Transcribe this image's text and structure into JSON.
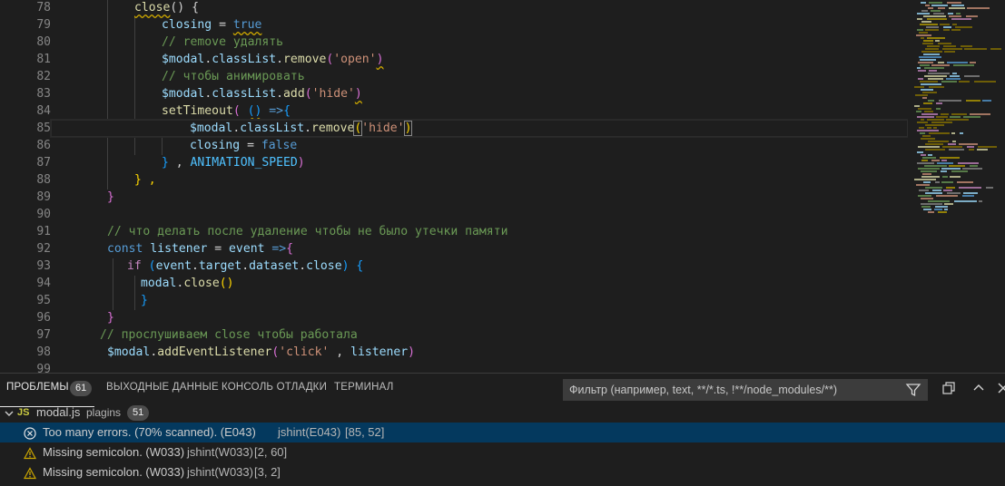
{
  "editor": {
    "lines": [
      {
        "n": "78"
      },
      {
        "n": "79"
      },
      {
        "n": "80"
      },
      {
        "n": "81"
      },
      {
        "n": "82"
      },
      {
        "n": "83"
      },
      {
        "n": "84"
      },
      {
        "n": "85"
      },
      {
        "n": "86"
      },
      {
        "n": "87"
      },
      {
        "n": "88"
      },
      {
        "n": "89"
      },
      {
        "n": "90"
      },
      {
        "n": "91"
      },
      {
        "n": "92"
      },
      {
        "n": "93"
      },
      {
        "n": "94"
      },
      {
        "n": "95"
      },
      {
        "n": "96"
      },
      {
        "n": "97"
      },
      {
        "n": "98"
      },
      {
        "n": "99"
      }
    ],
    "code": {
      "l78": {
        "fn": "close",
        "rest": "() {"
      },
      "l79": {
        "var": "closing",
        "eq": " = ",
        "val": "true"
      },
      "l80": {
        "comment": "// remove удалять"
      },
      "l81": {
        "obj": "$modal",
        "dot": ".",
        "prop": "classList",
        "dot2": ".",
        "method": "remove",
        "open": "(",
        "str": "'open'",
        "close": ")"
      },
      "l82": {
        "comment": "// чтобы анимировать"
      },
      "l83": {
        "obj": "$modal",
        "dot": ".",
        "prop": "classList",
        "dot2": ".",
        "method": "add",
        "open": "(",
        "str": "'hide'",
        "close": ")"
      },
      "l84": {
        "fn": "setTimeout",
        "open": "(",
        "sp": " ",
        "args": "()",
        "arrow": " =>",
        "brace": "{"
      },
      "l85": {
        "obj": "$modal",
        "dot": ".",
        "prop": "classList",
        "dot2": ".",
        "method": "remove",
        "open": "(",
        "str": "'hide'",
        "close": ")"
      },
      "l86": {
        "var": "closing",
        "eq": " = ",
        "val": "false"
      },
      "l87": {
        "brace": "}",
        "sep": " , ",
        "const": "ANIMATION_SPEED",
        "close": ")"
      },
      "l88": {
        "text": "} ,"
      },
      "l89": {
        "brace": "}"
      },
      "l91": {
        "comment": "// что делать после удаление чтобы не было утечки памяти"
      },
      "l92": {
        "kw": "const",
        "sp": " ",
        "var": "listener",
        "eq": " = ",
        "param": "event",
        "arrow": " =>",
        "brace": "{"
      },
      "l93": {
        "kw": "if",
        "sp": " ",
        "open": "(",
        "e1": "event",
        "d1": ".",
        "e2": "target",
        "d2": ".",
        "e3": "dataset",
        "d3": ".",
        "e4": "close",
        "close": ")",
        "brace": " {"
      },
      "l94": {
        "obj": "modal",
        "dot": ".",
        "method": "close",
        "paren": "()"
      },
      "l95": {
        "brace": "}"
      },
      "l96": {
        "brace": "}"
      },
      "l97": {
        "comment": "// прослушиваем close чтобы работала"
      },
      "l98": {
        "obj": "$modal",
        "dot": ".",
        "method": "addEventListener",
        "open": "(",
        "str": "'click'",
        "sep": " , ",
        "var": "listener",
        "close": ")"
      }
    }
  },
  "panel": {
    "tabs": [
      {
        "label": "ПРОБЛЕМЫ",
        "badge": "61"
      },
      {
        "label": "ВЫХОДНЫЕ ДАННЫЕ"
      },
      {
        "label": "КОНСОЛЬ ОТЛАДКИ"
      },
      {
        "label": "ТЕРМИНАЛ"
      }
    ],
    "filter_placeholder": "Фильтр (например, text, **/*.ts, !**/node_modules/**)",
    "file": {
      "icon_label": "JS",
      "name": "modal.js",
      "folder": "plagins",
      "count": "51"
    },
    "problems": [
      {
        "severity": "error",
        "message": "Too many errors. (70% scanned). (E043)",
        "source": "jshint(E043)",
        "pos": "[85, 52]"
      },
      {
        "severity": "warning",
        "message": "Missing semicolon. (W033)",
        "source": "jshint(W033)",
        "pos": "[2, 60]"
      },
      {
        "severity": "warning",
        "message": "Missing semicolon. (W033)",
        "source": "jshint(W033)",
        "pos": "[3, 2]"
      }
    ]
  },
  "colors": {
    "accent": "#04395e",
    "error": "#f48771",
    "warning": "#cca700",
    "js_icon": "#cbcb41"
  }
}
